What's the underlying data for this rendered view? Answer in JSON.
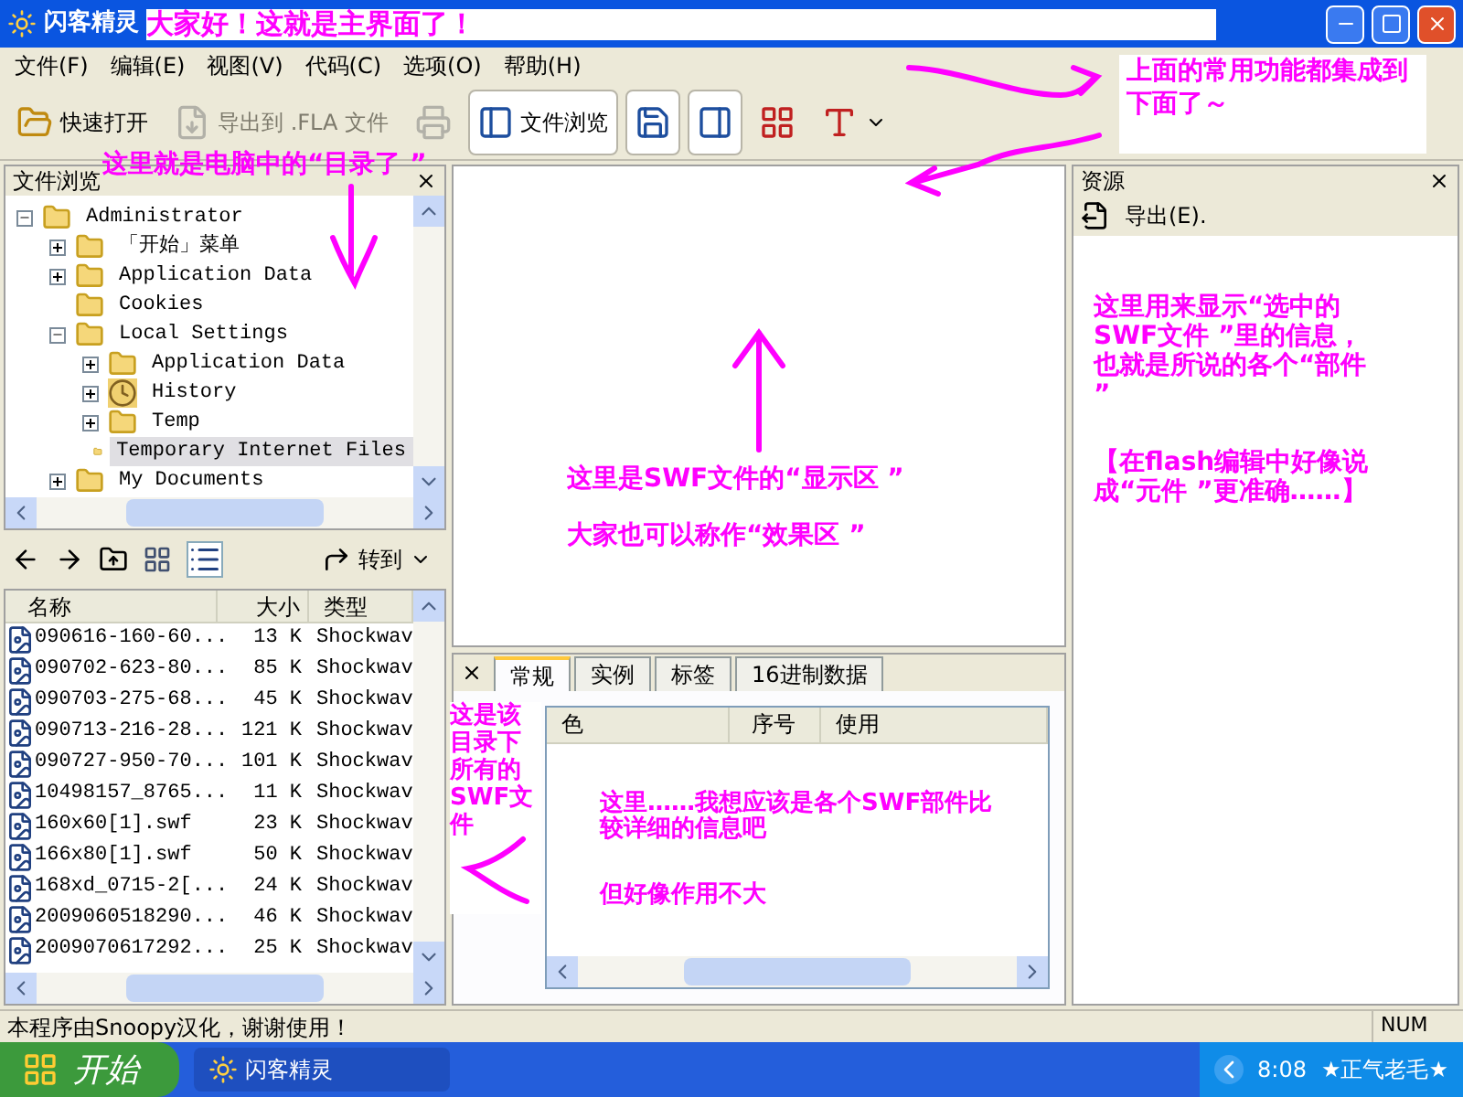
{
  "window": {
    "title": "闪客精灵"
  },
  "menu": [
    "文件(F)",
    "编辑(E)",
    "视图(V)",
    "代码(C)",
    "选项(O)",
    "帮助(H)"
  ],
  "toolbar": [
    {
      "kind": "open",
      "label": "快速打开",
      "disabled": false,
      "selected": false
    },
    {
      "kind": "export",
      "label": "导出到 .FLA 文件",
      "disabled": true,
      "selected": false
    },
    {
      "kind": "print",
      "disabled": true,
      "selected": false
    },
    {
      "kind": "browse",
      "label": "文件浏览",
      "disabled": false,
      "selected": true
    },
    {
      "kind": "display",
      "disabled": false,
      "selected": true
    },
    {
      "kind": "resources",
      "disabled": false,
      "selected": true
    },
    {
      "kind": "colors",
      "disabled": false,
      "selected": false
    },
    {
      "kind": "font",
      "disabled": false,
      "selected": false
    }
  ],
  "file_browser": {
    "title": "文件浏览",
    "tree": [
      {
        "label": "Administrator",
        "expanded": true,
        "selected": false,
        "children": [
          {
            "label": "「开始」菜单",
            "expanded": false,
            "selected": false
          },
          {
            "label": "Application Data",
            "expanded": false,
            "selected": false
          },
          {
            "label": "Cookies",
            "selected": false
          },
          {
            "label": "Local Settings",
            "expanded": true,
            "selected": false,
            "children": [
              {
                "label": "Application Data",
                "expanded": false,
                "selected": false
              },
              {
                "label": "History",
                "kind": "history",
                "expanded": false,
                "selected": false
              },
              {
                "label": "Temp",
                "expanded": false,
                "selected": false
              },
              {
                "label": "Temporary Internet Files",
                "selected": true
              }
            ]
          },
          {
            "label": "My Documents",
            "expanded": false,
            "selected": false
          }
        ]
      }
    ]
  },
  "file_list": {
    "goto": "转到",
    "columns": [
      "名称",
      "大小",
      "类型"
    ],
    "rows": [
      [
        "090616-160-60...",
        "13 K",
        "Shockwav"
      ],
      [
        "090702-623-80...",
        "85 K",
        "Shockwav"
      ],
      [
        "090703-275-68...",
        "45 K",
        "Shockwav"
      ],
      [
        "090713-216-28...",
        "121 K",
        "Shockwav"
      ],
      [
        "090727-950-70...",
        "101 K",
        "Shockwav"
      ],
      [
        "10498157_8765...",
        "11 K",
        "Shockwav"
      ],
      [
        "160x60[1].swf",
        "23 K",
        "Shockwav"
      ],
      [
        "166x80[1].swf",
        "50 K",
        "Shockwav"
      ],
      [
        "168xd_0715-2[...",
        "24 K",
        "Shockwav"
      ],
      [
        "2009060518290...",
        "46 K",
        "Shockwav"
      ],
      [
        "2009070617292...",
        "25 K",
        "Shockwav"
      ]
    ]
  },
  "details": {
    "tabs": [
      {
        "label": "常规",
        "selected": true
      },
      {
        "label": "实例",
        "selected": false
      },
      {
        "label": "标签",
        "selected": false
      },
      {
        "label": "16进制数据",
        "selected": false
      }
    ],
    "columns": [
      "色",
      "序号",
      "使用"
    ]
  },
  "resources": {
    "title": "资源",
    "export": "导出(E)."
  },
  "status_bar": {
    "message": "本程序由Snoopy汉化，谢谢使用！",
    "num": "NUM"
  },
  "taskbar": {
    "start": "开始",
    "task": "闪客精灵",
    "time": "8:08",
    "user": "★正气老毛★"
  },
  "annotations": {
    "title": "大家好！这就是主界面了！",
    "toolbar": "上面的常用功能都集成到下面了～",
    "tree": "这里就是电脑中的“目录了 ”",
    "display": [
      "这里是SWF文件的“显示区 ”",
      "大家也可以称作“效果区 ”"
    ],
    "list": "这是该目录下所有的SWF文件",
    "details": [
      "这里……我想应该是各个SWF部件比较详细的信息吧",
      "但好像作用不大"
    ],
    "resources": [
      "这里用来显示“选中的SWF文件 ”里的信息，也就是所说的各个“部件 ”",
      "【在flash编辑中好像说成“元件 ”更准确……】"
    ]
  }
}
